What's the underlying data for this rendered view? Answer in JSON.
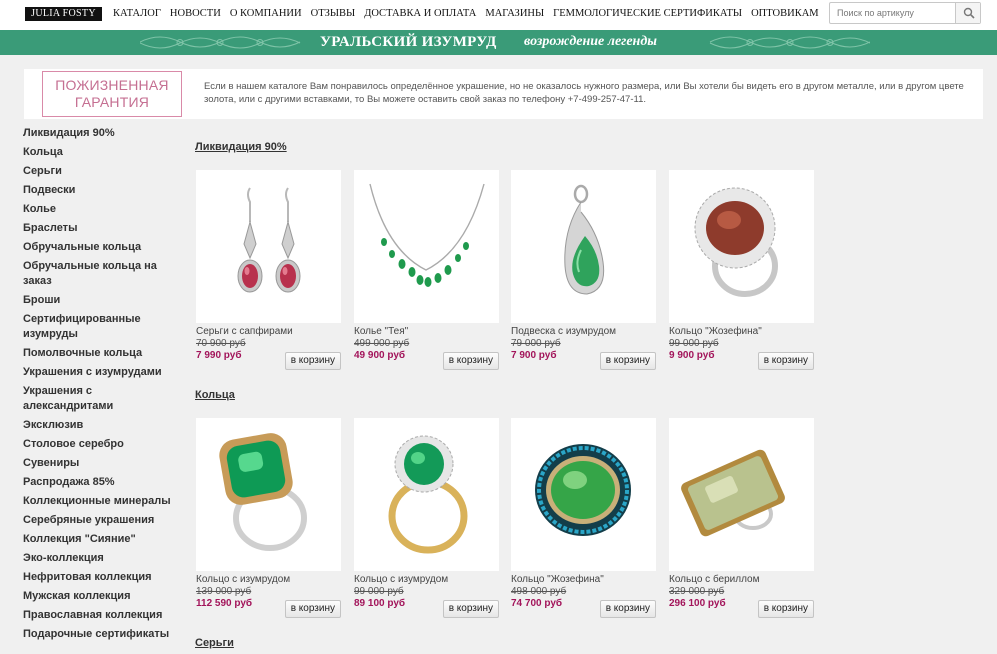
{
  "header": {
    "logo": "JULIA FOSTY",
    "nav": [
      "КАТАЛОГ",
      "НОВОСТИ",
      "О КОМПАНИИ",
      "ОТЗЫВЫ",
      "ДОСТАВКА И ОПЛАТА",
      "МАГАЗИНЫ",
      "ГЕММОЛОГИЧЕСКИЕ СЕРТИФИКАТЫ",
      "ОПТОВИКАМ"
    ],
    "search_placeholder": "Поиск по артикулу"
  },
  "banner": {
    "title": "УРАЛЬСКИЙ ИЗУМРУД",
    "subtitle": "возрождение легенды",
    "color": "#3a9b78"
  },
  "info": {
    "guarantee_line1": "ПОЖИЗНЕННАЯ",
    "guarantee_line2": "ГАРАНТИЯ",
    "text": "Если в нашем каталоге Вам понравилось определённое украшение, но не оказалось нужного размера, или Вы хотели бы видеть его в другом металле, или в другом цвете золота, или с другими вставками, то Вы можете оставить свой заказ по телефону +7-499-257-47-11."
  },
  "sidebar": {
    "items": [
      "Ликвидация 90%",
      "Кольца",
      "Серьги",
      "Подвески",
      "Колье",
      "Браслеты",
      "Обручальные кольца",
      "Обручальные кольца на заказ",
      "Броши",
      "Сертифицированные изумруды",
      "Помолвочные кольца",
      "Украшения с изумрудами",
      "Украшения с александритами",
      "Эксклюзив",
      "Столовое серебро",
      "Сувениры",
      "Распродажа 85%",
      "Коллекционные минералы",
      "Серебряные украшения",
      "Коллекция \"Сияние\"",
      "Эко-коллекция",
      "Нефритовая коллекция",
      "Мужская коллекция",
      "Православная коллекция",
      "Подарочные сертификаты"
    ]
  },
  "cart_label": "в корзину",
  "sections": [
    {
      "title": "Ликвидация 90%",
      "products": [
        {
          "name": "Серьги с сапфирами",
          "old_price": "70 900 руб",
          "new_price": "7 990 руб",
          "icon": "earrings-icon"
        },
        {
          "name": "Колье \"Тея\"",
          "old_price": "499 000 руб",
          "new_price": "49 900 руб",
          "icon": "necklace-icon"
        },
        {
          "name": "Подвеска с изумрудом",
          "old_price": "79 000 руб",
          "new_price": "7 900 руб",
          "icon": "pendant-icon"
        },
        {
          "name": "Кольцо \"Жозефина\"",
          "old_price": "99 000 руб",
          "new_price": "9 900 руб",
          "icon": "ring-icon"
        }
      ]
    },
    {
      "title": "Кольца",
      "products": [
        {
          "name": "Кольцо с изумрудом",
          "old_price": "139 000 руб",
          "new_price": "112 590 руб",
          "icon": "ring-icon"
        },
        {
          "name": "Кольцо с изумрудом",
          "old_price": "99 000 руб",
          "new_price": "89 100 руб",
          "icon": "ring-icon"
        },
        {
          "name": "Кольцо \"Жозефина\"",
          "old_price": "498 000 руб",
          "new_price": "74 700 руб",
          "icon": "ring-icon"
        },
        {
          "name": "Кольцо с бериллом",
          "old_price": "329 000 руб",
          "new_price": "296 100 руб",
          "icon": "ring-icon"
        }
      ]
    },
    {
      "title": "Серьги",
      "products": []
    }
  ]
}
